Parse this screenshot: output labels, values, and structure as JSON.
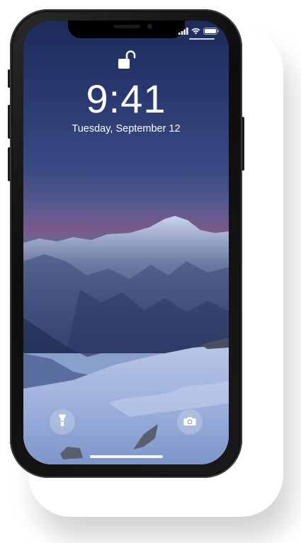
{
  "lock_screen": {
    "time": "9:41",
    "date": "Tuesday, September 12"
  },
  "status_bar": {
    "icons": [
      "signal-icon",
      "wifi-icon",
      "battery-icon"
    ]
  },
  "quick_actions": {
    "left": "flashlight-icon",
    "right": "camera-icon"
  },
  "colors": {
    "sky_top": "#1e2b5a",
    "sky_horizon": "#7a5a8a",
    "snow": "#a4b4d8",
    "device_frame": "#111111"
  }
}
